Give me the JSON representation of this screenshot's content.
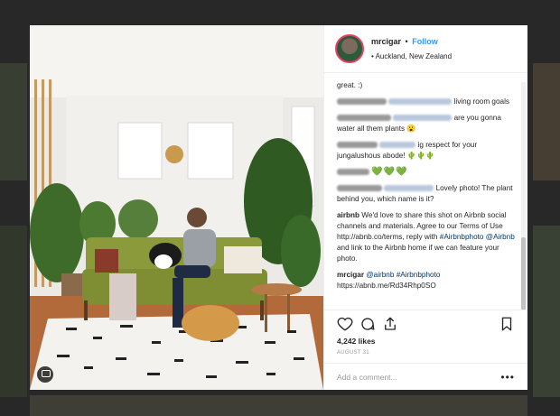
{
  "post": {
    "username": "mrcigar",
    "separator": "•",
    "follow_label": "Follow",
    "location": "• Auckland, New Zealand",
    "likes": "4,242 likes",
    "date": "AUGUST 31",
    "add_comment_placeholder": "Add a comment...",
    "more_label": "•••"
  },
  "comments": {
    "c1_text": "great. :)",
    "c2_text": "living room goals",
    "c3_text": "are you gonna water all them plants 😮",
    "c4_text": "ig respect for your jungalushous abode! 🌵🌵🌵",
    "c5_text": "💚💚💚",
    "c6_text": "Lovely photo! The plant behind you, which name is it?",
    "c7_user": "airbnb",
    "c7_text": " We'd love to share this shot on Airbnb social channels and materials. Agree to our Terms of Use http://abnb.co/terms, reply with ",
    "c7_tag1": "#Airbnbphoto",
    "c7_sp": " ",
    "c7_tag2": "@Airbnb",
    "c7_tail": " and link to the Airbnb home if we can feature your photo.",
    "c8_user": "mrcigar",
    "c8_sp": " ",
    "c8_tag1": "@airbnb",
    "c8_tag2": "#Airbnbphoto",
    "c8_tail": "https://abnb.me/Rd34Rhp0SO"
  },
  "icons": {
    "like": "heart-outline-icon",
    "comment": "comment-bubble-icon",
    "share": "share-icon",
    "save": "bookmark-icon"
  },
  "colors": {
    "link_blue": "#3897f0",
    "tag_blue": "#003569",
    "sofa_green": "#8b9a3a"
  }
}
